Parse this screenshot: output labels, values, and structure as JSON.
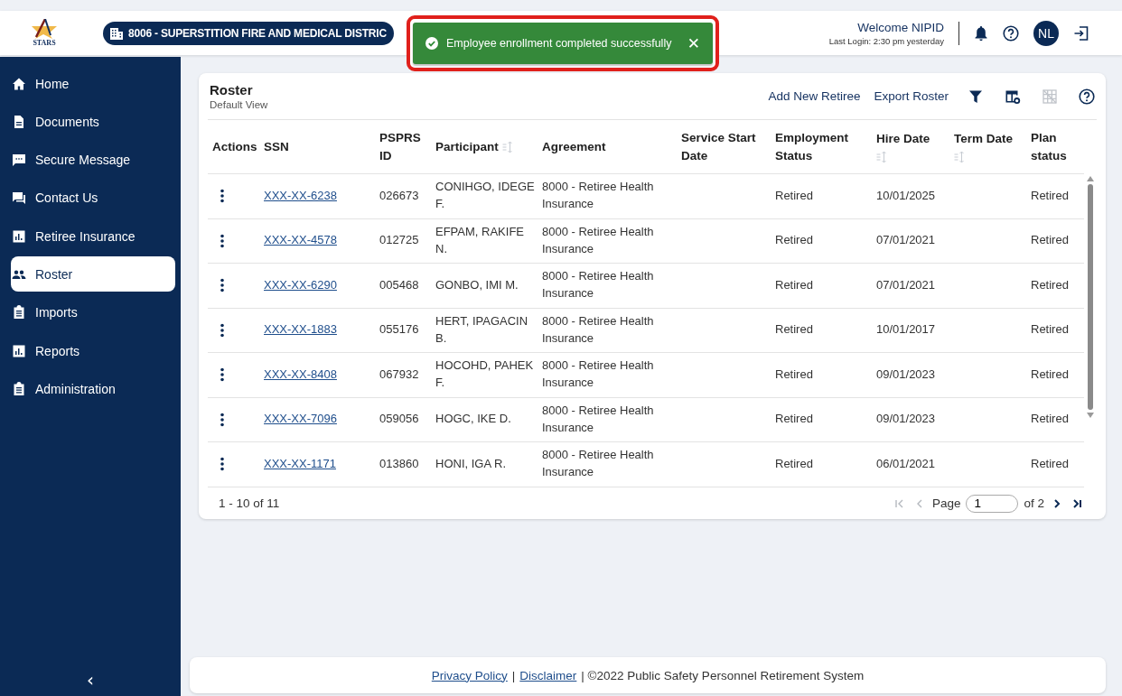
{
  "header": {
    "logo_text": "STARS",
    "employer": "8006 - SUPERSTITION FIRE AND MEDICAL DISTRIC",
    "welcome": "Welcome NIPID",
    "last_login": "Last Login: 2:30 pm yesterday",
    "avatar": "NL"
  },
  "toast": {
    "message": "Employee enrollment completed successfully",
    "close": "✕"
  },
  "sidebar": {
    "items": [
      {
        "label": "Home",
        "kind": "home",
        "selected": false
      },
      {
        "label": "Documents",
        "kind": "document",
        "selected": false
      },
      {
        "label": "Secure Message",
        "kind": "message",
        "selected": false
      },
      {
        "label": "Contact Us",
        "kind": "chat",
        "selected": false
      },
      {
        "label": "Retiree Insurance",
        "kind": "chart",
        "selected": false
      },
      {
        "label": "Roster",
        "kind": "people",
        "selected": true
      },
      {
        "label": "Imports",
        "kind": "clipboard",
        "selected": false
      },
      {
        "label": "Reports",
        "kind": "chart",
        "selected": false
      },
      {
        "label": "Administration",
        "kind": "clipboard",
        "selected": false
      }
    ],
    "collapse": "‹"
  },
  "roster": {
    "title": "Roster",
    "subtitle": "Default View",
    "links": [
      "Add New Retiree",
      "Export Roster"
    ],
    "tools": [
      {
        "kind": "filter",
        "disabled": false
      },
      {
        "kind": "columns",
        "disabled": false
      },
      {
        "kind": "grid",
        "disabled": true
      },
      {
        "kind": "help",
        "disabled": false
      }
    ],
    "columns": [
      {
        "label": "Actions",
        "sortable": false
      },
      {
        "label": "SSN",
        "sortable": false
      },
      {
        "label": "PSPRS ID",
        "sortable": false
      },
      {
        "label": "Participant",
        "sortable": true
      },
      {
        "label": "Agreement",
        "sortable": false
      },
      {
        "label": "Service Start Date",
        "sortable": false
      },
      {
        "label": "Employment Status",
        "sortable": false
      },
      {
        "label": "Hire Date",
        "sortable": true
      },
      {
        "label": "Term Date",
        "sortable": true
      },
      {
        "label": "Plan status",
        "sortable": false
      }
    ],
    "rows": [
      {
        "ssn": "XXX-XX-6238",
        "id": "026673",
        "participant": "CONIHGO, IDEGE F.",
        "agreement": "8000 - Retiree Health Insurance",
        "employment": "Retired",
        "hire": "10/01/2025",
        "plan": "Retired"
      },
      {
        "ssn": "XXX-XX-4578",
        "id": "012725",
        "participant": "EFPAM, RAKIFE N.",
        "agreement": "8000 - Retiree Health Insurance",
        "employment": "Retired",
        "hire": "07/01/2021",
        "plan": "Retired"
      },
      {
        "ssn": "XXX-XX-6290",
        "id": "005468",
        "participant": "GONBO, IMI M.",
        "agreement": "8000 - Retiree Health Insurance",
        "employment": "Retired",
        "hire": "07/01/2021",
        "plan": "Retired"
      },
      {
        "ssn": "XXX-XX-1883",
        "id": "055176",
        "participant": "HERT, IPAGACIN B.",
        "agreement": "8000 - Retiree Health Insurance",
        "employment": "Retired",
        "hire": "10/01/2017",
        "plan": "Retired"
      },
      {
        "ssn": "XXX-XX-8408",
        "id": "067932",
        "participant": "HOCOHD, PAHEK F.",
        "agreement": "8000 - Retiree Health Insurance",
        "employment": "Retired",
        "hire": "09/01/2023",
        "plan": "Retired"
      },
      {
        "ssn": "XXX-XX-7096",
        "id": "059056",
        "participant": "HOGC, IKE D.",
        "agreement": "8000 - Retiree Health Insurance",
        "employment": "Retired",
        "hire": "09/01/2023",
        "plan": "Retired"
      },
      {
        "ssn": "XXX-XX-1171",
        "id": "013860",
        "participant": "HONI, IGA R.",
        "agreement": "8000 - Retiree Health Insurance",
        "employment": "Retired",
        "hire": "06/01/2021",
        "plan": "Retired"
      }
    ],
    "pagination": {
      "summary": "1 - 10 of 11",
      "page_label": "Page",
      "page": "1",
      "of_label": "of 2",
      "buttons": [
        {
          "kind": "first",
          "disabled": true
        },
        {
          "kind": "prev",
          "disabled": true
        },
        {
          "kind": "next",
          "disabled": false
        },
        {
          "kind": "last",
          "disabled": false
        }
      ]
    }
  },
  "footer": [
    {
      "kind": "link",
      "text": "Privacy Policy"
    },
    {
      "kind": "text",
      "text": "|"
    },
    {
      "kind": "link",
      "text": "Disclaimer"
    },
    {
      "kind": "text",
      "text": "| ©2022 Public Safety Personnel Retirement System"
    }
  ]
}
